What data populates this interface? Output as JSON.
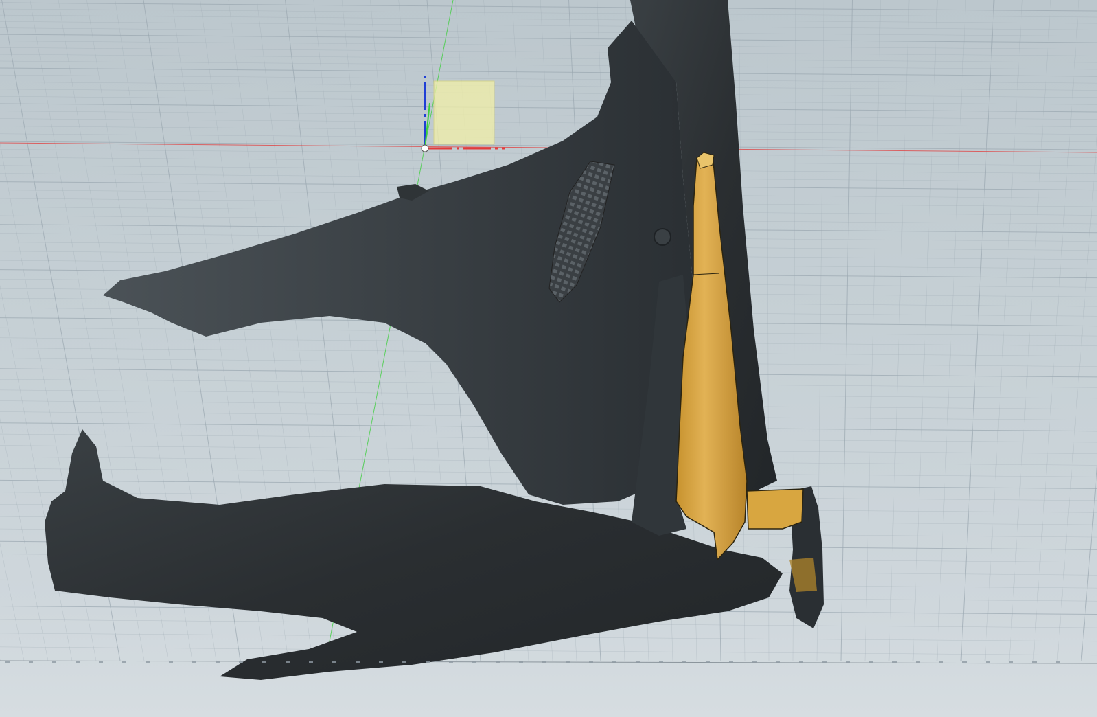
{
  "viewport": {
    "background_top": "#bcc7cd",
    "background_bottom": "#d6dde1",
    "grid_color": "#9aa7b0",
    "x_axis_color": "#e23b3b",
    "y_axis_color": "#3ecf3e",
    "z_axis_color": "#1f3fd6"
  },
  "model": {
    "scan_mesh_color": "#2c3033",
    "bracket_color": "#d8a640",
    "sketch_plane_color": "#f2f0a8"
  },
  "ruler": {
    "tick_labels": []
  }
}
